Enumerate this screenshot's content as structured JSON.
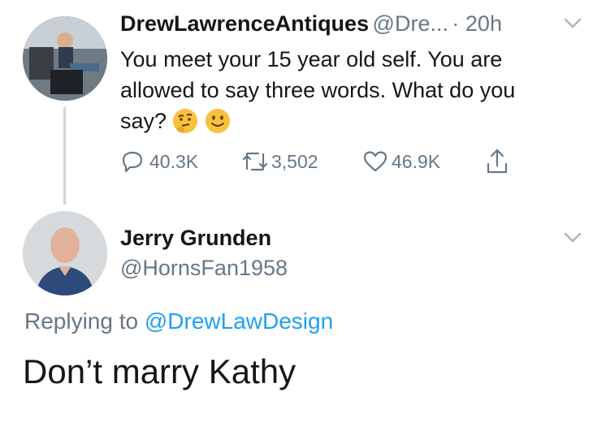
{
  "tweet": {
    "display_name": "DrewLawrenceAntiques",
    "handle": "@Dre...",
    "time": "· 20h",
    "text_lines": [
      "You meet your 15 year old self. You are",
      "allowed to say three words. What do you",
      "say?"
    ],
    "emojis": [
      "thinking-face",
      "slightly-smiling-face"
    ],
    "actions": {
      "replies": "40.3K",
      "retweets": "3,502",
      "likes": "46.9K"
    }
  },
  "reply": {
    "display_name": "Jerry Grunden",
    "handle": "@HornsFan1958",
    "replying_to_prefix": "Replying to",
    "replying_to_handle": "@DrewLawDesign",
    "text": "Don’t marry Kathy"
  },
  "colors": {
    "text": "#14171a",
    "muted": "#657786",
    "link": "#1da1f2",
    "divider": "#ccd6dd",
    "emoji": "#f7c13a"
  }
}
